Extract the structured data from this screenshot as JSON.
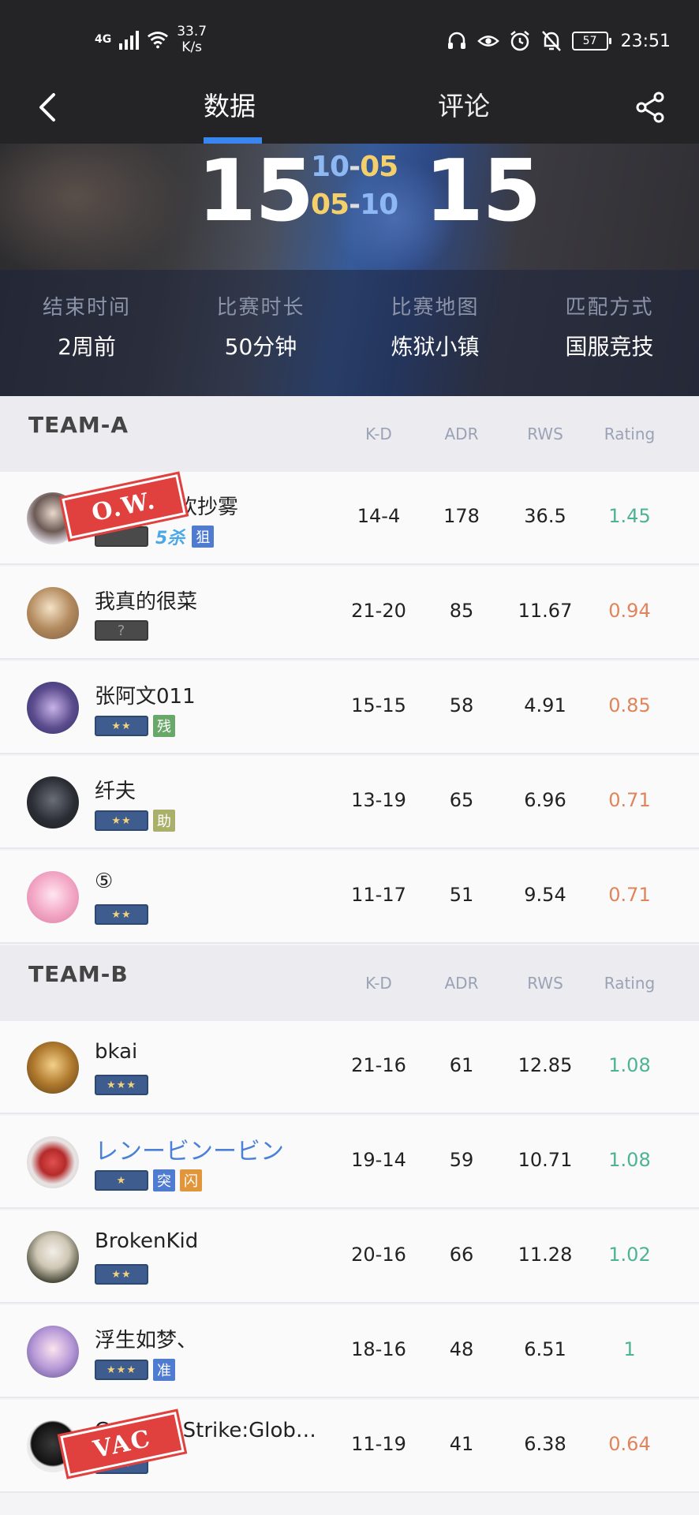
{
  "status_bar": {
    "network": "4G",
    "speed_value": "33.7",
    "speed_unit": "K/s",
    "battery": "57",
    "time": "23:51"
  },
  "nav": {
    "tabs": [
      "数据",
      "评论"
    ],
    "active_tab": "数据"
  },
  "match": {
    "score_left": "15",
    "score_right": "15",
    "half1_a": "10",
    "half1_b": "05",
    "half2_a": "05",
    "half2_b": "10",
    "info": [
      {
        "label": "结束时间",
        "value": "2周前"
      },
      {
        "label": "比赛时长",
        "value": "50分钟"
      },
      {
        "label": "比赛地图",
        "value": "炼狱小镇"
      },
      {
        "label": "匹配方式",
        "value": "国服竞技"
      }
    ]
  },
  "columns": [
    "K-D",
    "ADR",
    "RWS",
    "Rating"
  ],
  "team_a": {
    "name": "TEAM-A",
    "players": [
      {
        "name": "我真的喜欢抄雾",
        "rank": "",
        "tags": [
          "5杀",
          "狙"
        ],
        "kd": "14-4",
        "adr": "178",
        "rws": "36.5",
        "rating": "1.45",
        "stamp": "O.W."
      },
      {
        "name": "我真的很菜",
        "rank": "?",
        "tags": [],
        "kd": "21-20",
        "adr": "85",
        "rws": "11.67",
        "rating": "0.94"
      },
      {
        "name": "张阿文011",
        "rank": "★★",
        "tags": [
          "残"
        ],
        "kd": "15-15",
        "adr": "58",
        "rws": "4.91",
        "rating": "0.85"
      },
      {
        "name": "纤夫",
        "rank": "★★",
        "tags": [
          "助"
        ],
        "kd": "13-19",
        "adr": "65",
        "rws": "6.96",
        "rating": "0.71"
      },
      {
        "name": "⑤",
        "rank": "★★",
        "tags": [],
        "kd": "11-17",
        "adr": "51",
        "rws": "9.54",
        "rating": "0.71"
      }
    ]
  },
  "team_b": {
    "name": "TEAM-B",
    "players": [
      {
        "name": "bkai",
        "rank": "★★★",
        "tags": [],
        "kd": "21-16",
        "adr": "61",
        "rws": "12.85",
        "rating": "1.08"
      },
      {
        "name": "レンービンービン",
        "rank": "★",
        "tags": [
          "突",
          "闪"
        ],
        "kd": "19-14",
        "adr": "59",
        "rws": "10.71",
        "rating": "1.08"
      },
      {
        "name": "BrokenKid",
        "rank": "★★",
        "tags": [],
        "kd": "20-16",
        "adr": "66",
        "rws": "11.28",
        "rating": "1.02"
      },
      {
        "name": "浮生如梦、",
        "rank": "★★★",
        "tags": [
          "准"
        ],
        "kd": "18-16",
        "adr": "48",
        "rws": "6.51",
        "rating": "1"
      },
      {
        "name": "Counter-Strike:Global ...",
        "rank": "★★",
        "tags": [],
        "kd": "11-19",
        "adr": "41",
        "rws": "6.38",
        "rating": "0.64",
        "stamp": "VAC"
      }
    ]
  },
  "colors": {
    "accent": "#3a86f0",
    "rating_good": "#4db394",
    "rating_bad": "#e0845c",
    "stamp": "#e0403e"
  }
}
